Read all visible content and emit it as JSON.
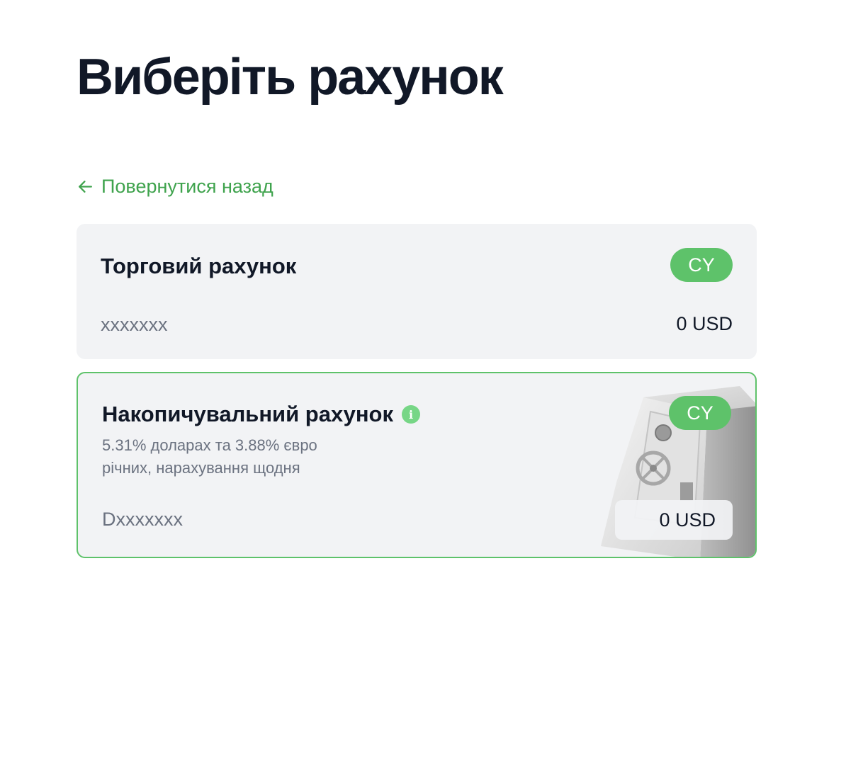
{
  "page": {
    "title": "Виберіть рахунок",
    "back_label": "Повернутися назад"
  },
  "accounts": [
    {
      "title": "Торговий рахунок",
      "badge": "CY",
      "number": "xxxxxxx",
      "balance": "0 USD"
    },
    {
      "title": "Накопичувальний рахунок",
      "badge": "CY",
      "description_line1": "5.31% доларах та 3.88% євро",
      "description_line2": "річних, нарахування щодня",
      "number": "Dxxxxxxx",
      "balance": "0 USD",
      "info_glyph": "i"
    }
  ],
  "colors": {
    "accent": "#5ec26a",
    "link": "#3fa34d",
    "card_bg": "#f2f3f5",
    "text": "#111827",
    "muted": "#6b7280"
  },
  "icons": {
    "back": "arrow-left-icon",
    "info": "info-icon",
    "safe": "safe-illustration"
  }
}
